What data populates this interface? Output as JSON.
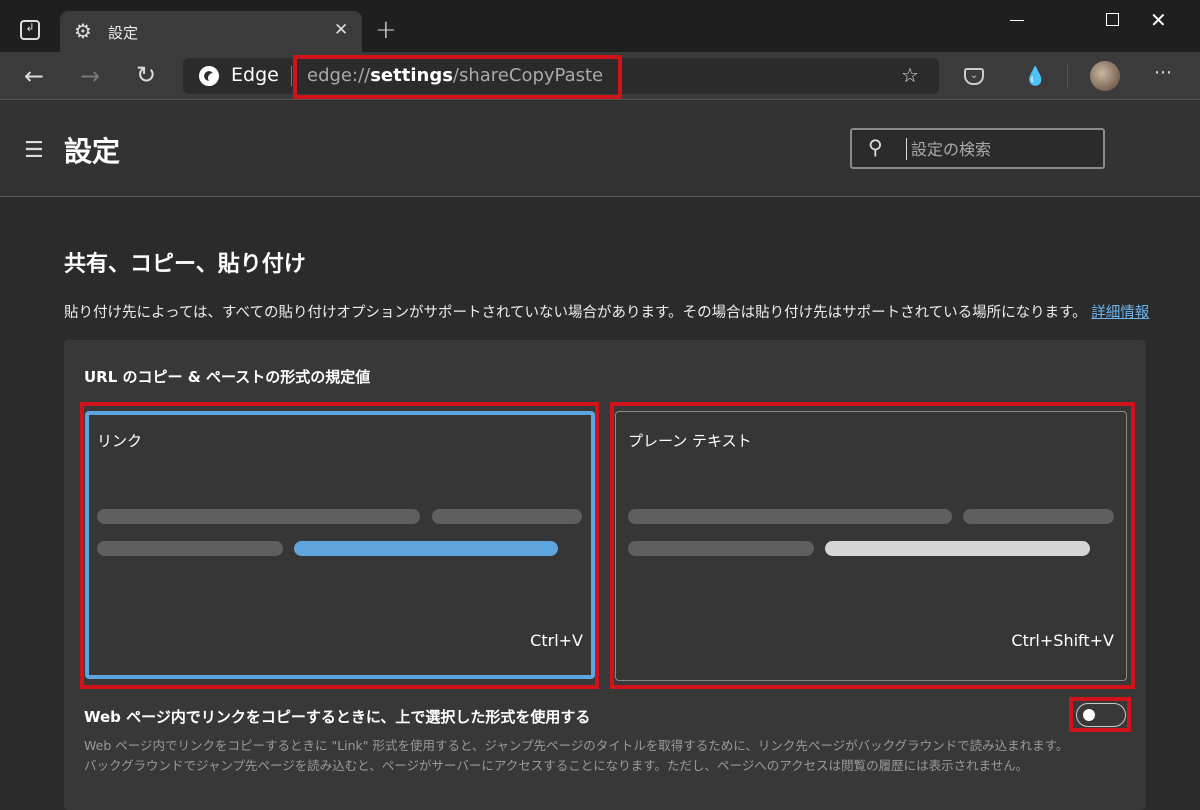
{
  "browser": {
    "tab_title": "設定",
    "new_tab_label": "+",
    "address_brand": "Edge",
    "url_prefix": "edge://",
    "url_bold": "settings",
    "url_suffix": "/shareCopyPaste",
    "icons": [
      "tab-actions-icon",
      "gear-icon",
      "close-icon",
      "new-tab-icon",
      "minimize-icon",
      "maximize-icon",
      "window-close-icon",
      "back-icon",
      "forward-icon",
      "refresh-icon",
      "edge-logo-icon",
      "favorite-add-icon",
      "pocket-icon",
      "drop-extension-icon",
      "avatar",
      "more-icon"
    ]
  },
  "header": {
    "title": "設定",
    "search_placeholder": "設定の検索"
  },
  "section": {
    "title": "共有、コピー、貼り付け",
    "description": "貼り付け先によっては、すべての貼り付けオプションがサポートされていない場合があります。その場合は貼り付け先はサポートされている場所になります。",
    "learn_more": "詳細情報"
  },
  "card": {
    "title": "URL のコピー & ペーストの形式の規定値",
    "options": [
      {
        "label": "リンク",
        "shortcut": "Ctrl+V",
        "selected": true
      },
      {
        "label": "プレーン テキスト",
        "shortcut": "Ctrl+Shift+V",
        "selected": false
      }
    ],
    "setting_title": "Web ページ内でリンクをコピーするときに、上で選択した形式を使用する",
    "setting_desc": "Web ページ内でリンクをコピーするときに \"Link\" 形式を使用すると、ジャンプ先ページのタイトルを取得するために、リンク先ページがバックグラウンドで読み込まれます。バックグラウンドでジャンプ先ページを読み込むと、ページがサーバーにアクセスすることになります。ただし、ページへのアクセスは閲覧の履歴には表示されません。",
    "toggle_on": false
  },
  "colors": {
    "accent": "#5ea5de",
    "highlight": "#d0121b",
    "link": "#6cb4f0"
  }
}
